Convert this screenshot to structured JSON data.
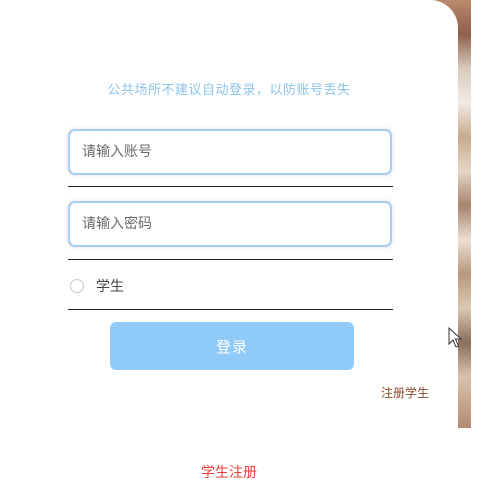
{
  "login_form": {
    "hint": "公共场所不建议自动登录，以防账号丢失",
    "account_placeholder": "请输入账号",
    "password_placeholder": "请输入密码",
    "role_option_label": "学生",
    "login_button": "登录",
    "register_student_link": "注册学生"
  },
  "footer": {
    "student_register_link": "学生注册"
  },
  "colors": {
    "hint_text": "#8cc4ea",
    "input_border": "#a9cdf0",
    "login_button_bg": "#8fcaf8",
    "register_small": "#8a4a2a",
    "register_big": "#e8403a"
  },
  "icons": {
    "cursor": "mouse-pointer-icon"
  }
}
